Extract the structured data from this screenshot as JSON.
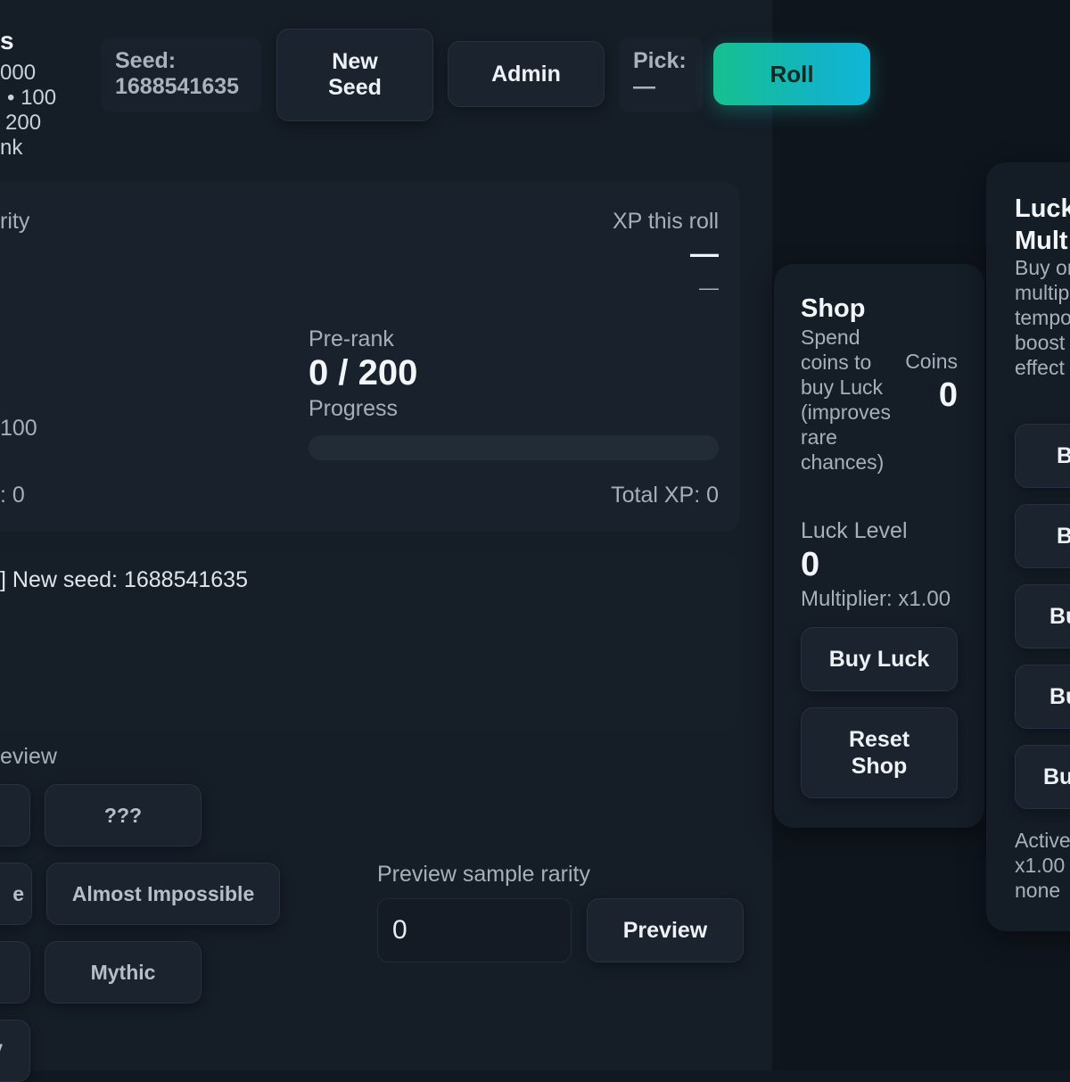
{
  "header": {
    "clipped_title": "s",
    "clipped_lines": [
      "000",
      "• 100",
      "200",
      "nk"
    ],
    "seed_label": "Seed:",
    "seed_value": "1688541635",
    "new_seed_label": "New Seed",
    "admin_label": "Admin",
    "pick_label": "Pick:",
    "pick_value": "—",
    "roll_label": "Roll"
  },
  "stats": {
    "clipped_rarity": "rity",
    "xp_label": "XP this roll",
    "xp_value": "—",
    "xp_sub": "—",
    "prerank_label": "Pre-rank",
    "prerank_value": "0 / 200",
    "progress_label": "Progress",
    "progress_fraction": 0,
    "clipped_100": "100",
    "clipped_zero": ": 0",
    "total_xp": "Total XP: 0"
  },
  "log": {
    "entry": "] New seed: 1688541635"
  },
  "preview": {
    "clipped_title": "eview",
    "rarity_buttons": [
      {
        "label": "???"
      },
      {
        "label": "Almost Impossible"
      },
      {
        "label": "Mythic"
      }
    ],
    "clipped_left_buttons": [
      "",
      "e",
      "",
      "y"
    ],
    "sample_label": "Preview sample rarity",
    "sample_value": "0",
    "preview_button": "Preview"
  },
  "shop": {
    "title": "Shop",
    "description": "Spend coins to buy Luck (improves rare chances)",
    "coins_label": "Coins",
    "coins_value": "0",
    "luck_level_label": "Luck Level",
    "luck_level_value": "0",
    "multiplier": "Multiplier: x1.00",
    "buy_luck": "Buy Luck",
    "reset_shop": "Reset Shop"
  },
  "luck_multipliers": {
    "title_line1": "Luck",
    "title_line2": "Mult",
    "desc_lines": [
      "Buy or",
      "multip",
      "tempo",
      "boost",
      "effect"
    ],
    "buttons": [
      "B",
      "B",
      "Bu",
      "Bu",
      "Bu"
    ],
    "active_lines": [
      "Active",
      "x1.00",
      "none"
    ]
  },
  "colors": {
    "roll_gradient_start": "#16c08f",
    "roll_gradient_end": "#0fb7d6"
  }
}
